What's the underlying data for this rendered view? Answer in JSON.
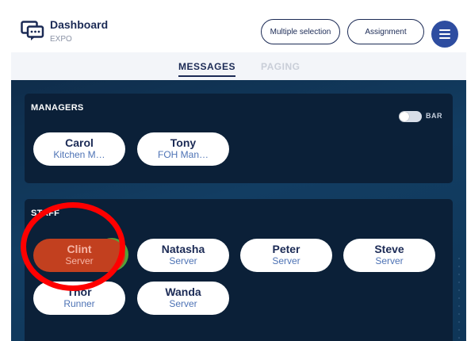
{
  "header": {
    "title": "Dashboard",
    "subtitle": "EXPO",
    "logo_icon": "chat-bubbles-icon",
    "multiple_selection_label": "Multiple selection",
    "assignment_label": "Assignment",
    "menu_icon": "hamburger-menu-icon"
  },
  "tabs": [
    {
      "label": "MESSAGES",
      "active": true
    },
    {
      "label": "PAGING",
      "active": false
    }
  ],
  "managers": {
    "title": "MANAGERS",
    "toggle_label": "BAR",
    "toggle_on": false,
    "people": [
      {
        "name": "Carol",
        "role": "Kitchen M…"
      },
      {
        "name": "Tony",
        "role": "FOH Man…"
      }
    ]
  },
  "staff": {
    "title": "STAFF",
    "people": [
      {
        "name": "Clint",
        "role": "Server",
        "selected": true
      },
      {
        "name": "Natasha",
        "role": "Server"
      },
      {
        "name": "Peter",
        "role": "Server"
      },
      {
        "name": "Steve",
        "role": "Server"
      },
      {
        "name": "Thor",
        "role": "Runner"
      },
      {
        "name": "Wanda",
        "role": "Server"
      }
    ]
  },
  "colors": {
    "brand_navy": "#1b2a55",
    "accent_blue": "#2e4da0",
    "selected_chip": "#c2401f",
    "status_online": "#52a43a",
    "highlight_ring": "#ff0000"
  }
}
